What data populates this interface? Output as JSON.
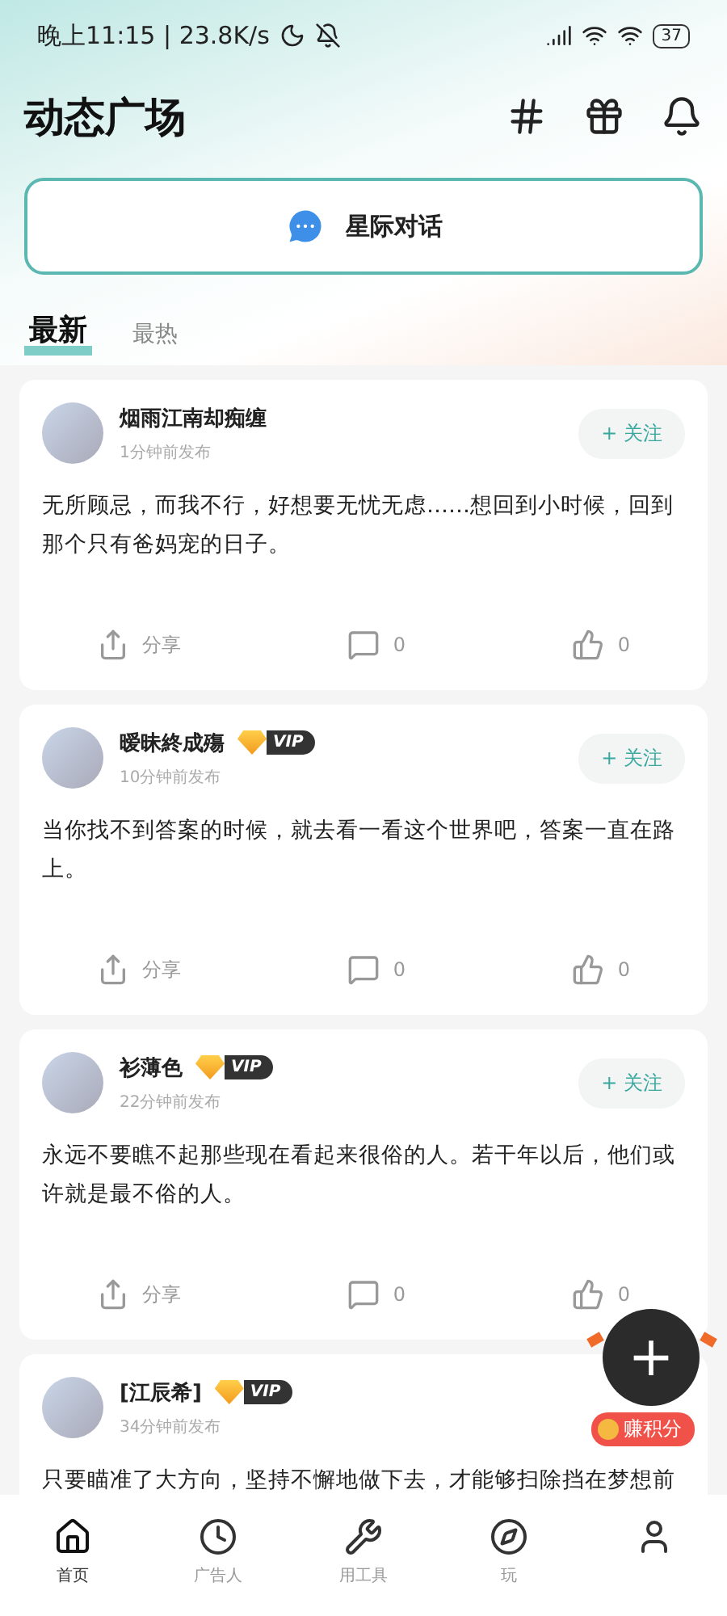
{
  "status_bar": {
    "time": "晚上11:15 | 23.8K/s",
    "battery": "37"
  },
  "header": {
    "title": "动态广场"
  },
  "banner": {
    "label": "星际对话"
  },
  "tabs": [
    {
      "label": "最新",
      "selected": true
    },
    {
      "label": "最热",
      "selected": false
    }
  ],
  "posts": [
    {
      "name": "烟雨江南却痴缠",
      "time": "1分钟前发布",
      "follow": "+ 关注",
      "text": "无所顾忌，而我不行，好想要无忧无虑……想回到小时候，回到那个只有爸妈宠的日子。",
      "share": "分享",
      "comments": "0",
      "likes": "0"
    },
    {
      "name": "暧昧終成殤",
      "vip": "VIP",
      "time": "10分钟前发布",
      "follow": "+ 关注",
      "text": "当你找不到答案的时候，就去看一看这个世界吧，答案一直在路上。",
      "share": "分享",
      "comments": "0",
      "likes": "0"
    },
    {
      "name": "衫薄色",
      "vip": "VIP",
      "time": "22分钟前发布",
      "follow": "+ 关注",
      "text": "永远不要瞧不起那些现在看起来很俗的人。若干年以后，他们或许就是最不俗的人。",
      "share": "分享",
      "comments": "0",
      "likes": "0"
    },
    {
      "name": "[江辰希]",
      "vip": "VIP",
      "time": "34分钟前发布",
      "text": "只要瞄准了大方向，坚持不懈地做下去，才能够扫除挡在梦想前"
    }
  ],
  "fab": {
    "symbol": "+",
    "badge": "赚积分"
  },
  "nav": [
    {
      "label": "首页",
      "kind": "home",
      "selected": true
    },
    {
      "label": "广告人",
      "kind": "clock",
      "selected": false
    },
    {
      "label": "用工具",
      "kind": "tools",
      "selected": false
    },
    {
      "label": "玩",
      "kind": "play",
      "selected": false
    },
    {
      "kind": "user",
      "selected": false
    }
  ]
}
